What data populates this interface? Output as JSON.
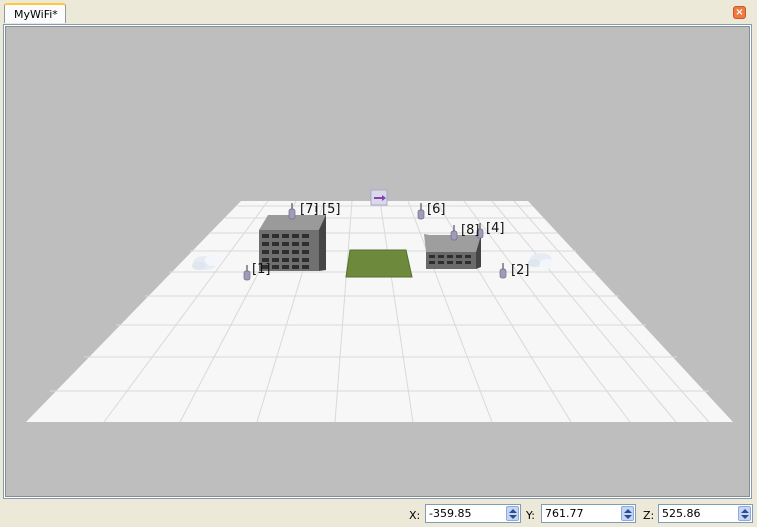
{
  "tab": {
    "title": "MyWiFi*"
  },
  "scene": {
    "access_points": [
      {
        "label": "[1]"
      },
      {
        "label": "[2]"
      },
      {
        "label": "[4]"
      },
      {
        "label": "[5]"
      },
      {
        "label": "[6]"
      },
      {
        "label": "[7]"
      },
      {
        "label": "[8]"
      }
    ]
  },
  "status": {
    "x": {
      "label": "X:",
      "value": "-359.85"
    },
    "y": {
      "label": "Y:",
      "value": "761.77"
    },
    "z": {
      "label": "Z:",
      "value": "525.86"
    }
  }
}
